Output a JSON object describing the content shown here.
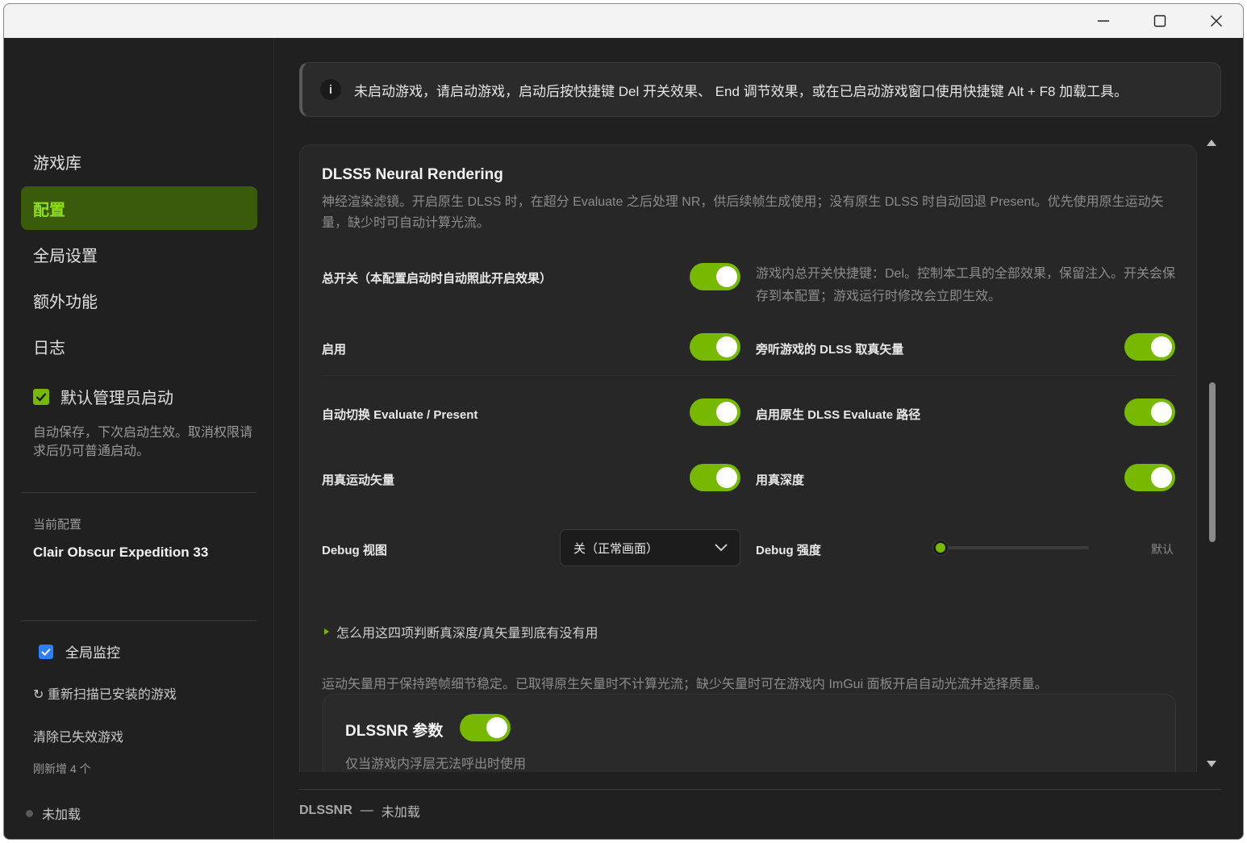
{
  "window": {
    "minimize_icon": "minimize-icon",
    "maximize_icon": "maximize-icon",
    "close_icon": "close-icon"
  },
  "sidebar": {
    "nav": [
      {
        "label": "游戏库",
        "active": false
      },
      {
        "label": "配置",
        "active": true
      },
      {
        "label": "全局设置",
        "active": false
      },
      {
        "label": "额外功能",
        "active": false
      },
      {
        "label": "日志",
        "active": false
      }
    ],
    "admin_checkbox": {
      "label": "默认管理员启动",
      "checked": true,
      "hint": "自动保存，下次启动生效。取消权限请求后仍可普通启动。"
    },
    "current_config_label": "当前配置",
    "current_config_name": "Clair Obscur Expedition 33",
    "global_monitor": {
      "label": "全局监控",
      "checked": true
    },
    "rescan_label": "↻ 重新扫描已安装的游戏",
    "clear_label": "清除已失效游戏",
    "new_count_label": "刚新增 4 个",
    "status_label": "未加载"
  },
  "info_banner": {
    "icon": "i",
    "text": "未启动游戏，请启动游戏，启动后按快捷键 Del 开关效果、 End 调节效果，或在已启动游戏窗口使用快捷键 Alt + F8 加载工具。"
  },
  "card": {
    "title": "DLSS5 Neural Rendering",
    "description": "神经渲染滤镜。开启原生 DLSS 时，在超分 Evaluate 之后处理 NR，供后续帧生成使用；没有原生 DLSS 时自动回退 Present。优先使用原生运动矢量，缺少时可自动计算光流。",
    "master_switch": {
      "label": "总开关（本配置启动时自动照此开启效果）",
      "on": true,
      "hint": "游戏内总开关快捷键：Del。控制本工具的全部效果，保留注入。开关会保存到本配置；游戏运行时修改会立即生效。"
    },
    "rows": [
      {
        "left_label": "启用",
        "left_on": true,
        "right_label": "旁听游戏的 DLSS 取真矢量",
        "right_on": true
      },
      {
        "left_label": "自动切换 Evaluate / Present",
        "left_on": true,
        "right_label": "启用原生 DLSS Evaluate 路径",
        "right_on": true
      },
      {
        "left_label": "用真运动矢量",
        "left_on": true,
        "right_label": "用真深度",
        "right_on": true
      }
    ],
    "debug_view": {
      "label": "Debug 视图",
      "selected": "关（正常画面）"
    },
    "debug_strength": {
      "label": "Debug 强度",
      "value_label": "默认",
      "level": 0
    },
    "expander_label": "怎么用这四项判断真深度/真矢量到底有没有用",
    "motion_note": "运动矢量用于保持跨帧细节稳定。已取得原生矢量时不计算光流；缺少矢量时可在游戏内 ImGui 面板开启自动光流并选择质量。",
    "subcard": {
      "title": "DLSSNR 参数",
      "on": true,
      "hint": "仅当游戏内浮层无法呼出时使用"
    }
  },
  "footer": {
    "name": "DLSSNR",
    "dash": "—",
    "status": "未加载"
  },
  "colors": {
    "accent": "#76b900",
    "active_bg": "#3a5a0c",
    "active_text": "#8ee01a",
    "checkbox_blue": "#2d7ff9"
  }
}
